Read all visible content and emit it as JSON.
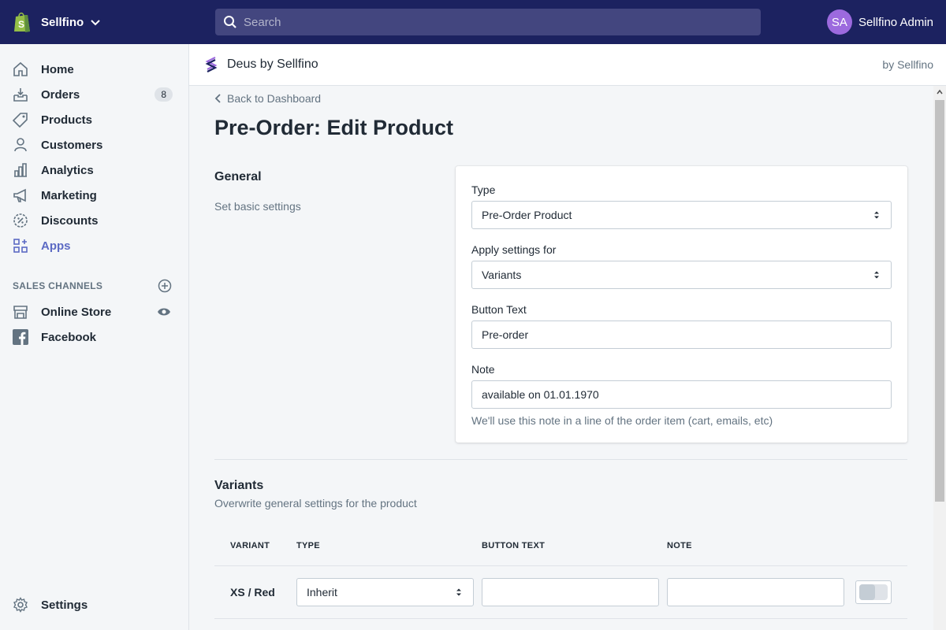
{
  "topbar": {
    "store_name": "Sellfino",
    "search_placeholder": "Search",
    "user_initials": "SA",
    "user_name": "Sellfino Admin"
  },
  "sidebar": {
    "items": [
      {
        "label": "Home",
        "icon": "home-icon"
      },
      {
        "label": "Orders",
        "icon": "orders-icon",
        "badge": "8"
      },
      {
        "label": "Products",
        "icon": "tag-icon"
      },
      {
        "label": "Customers",
        "icon": "person-icon"
      },
      {
        "label": "Analytics",
        "icon": "bar-chart-icon"
      },
      {
        "label": "Marketing",
        "icon": "megaphone-icon"
      },
      {
        "label": "Discounts",
        "icon": "discount-icon"
      },
      {
        "label": "Apps",
        "icon": "apps-icon",
        "active": true
      }
    ],
    "channels_title": "SALES CHANNELS",
    "channels": [
      {
        "label": "Online Store",
        "icon": "store-icon"
      },
      {
        "label": "Facebook",
        "icon": "facebook-icon"
      }
    ],
    "settings_label": "Settings"
  },
  "app_header": {
    "title": "Deus by Sellfino",
    "by": "by Sellfino"
  },
  "main": {
    "back_label": "Back to Dashboard",
    "page_title": "Pre-Order: Edit Product",
    "general": {
      "title": "General",
      "description": "Set basic settings",
      "type_label": "Type",
      "type_value": "Pre-Order Product",
      "apply_label": "Apply settings for",
      "apply_value": "Variants",
      "button_text_label": "Button Text",
      "button_text_value": "Pre-order",
      "note_label": "Note",
      "note_value": "available on 01.01.1970",
      "note_help": "We'll use this note in a line of the order item (cart, emails, etc)"
    },
    "variants": {
      "title": "Variants",
      "description": "Overwrite general settings for the product",
      "columns": [
        "VARIANT",
        "TYPE",
        "BUTTON TEXT",
        "NOTE"
      ],
      "rows": [
        {
          "variant": "XS / Red",
          "type": "Inherit",
          "button_text": "",
          "note": "",
          "enabled": false
        }
      ]
    }
  },
  "colors": {
    "topbar": "#1c2260",
    "search": "#43467f",
    "accent": "#5c6ac4",
    "avatar": "#9c6ade"
  }
}
